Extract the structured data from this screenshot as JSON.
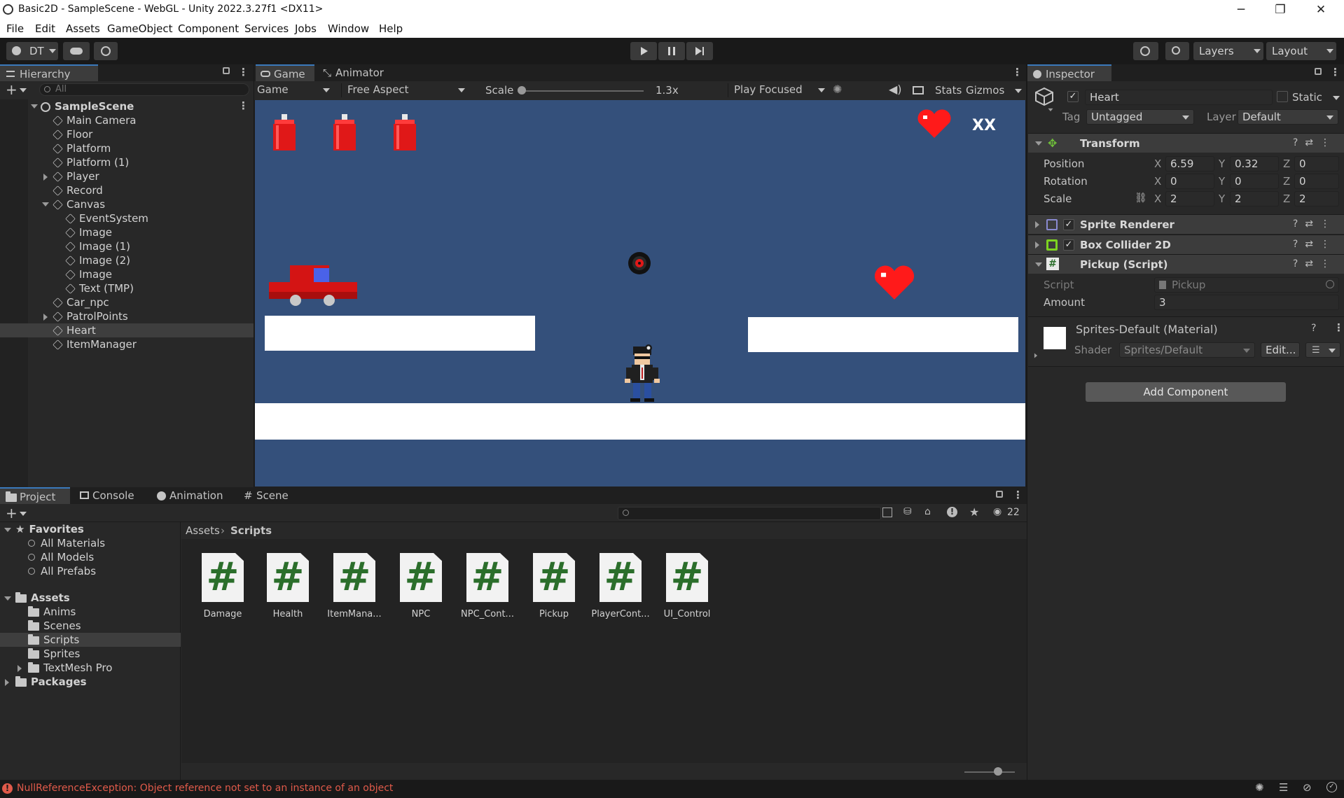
{
  "window": {
    "title": "Basic2D - SampleScene - WebGL - Unity 2022.3.27f1 <DX11>",
    "minimize": "─",
    "restore": "❐",
    "close": "✕"
  },
  "menu": [
    "File",
    "Edit",
    "Assets",
    "GameObject",
    "Component",
    "Services",
    "Jobs",
    "Window",
    "Help"
  ],
  "toolbar": {
    "account": "DT",
    "layers": "Layers",
    "layout": "Layout"
  },
  "hierarchy": {
    "tab": "Hierarchy",
    "search_placeholder": "All",
    "scene": "SampleScene",
    "items": [
      {
        "label": "Main Camera"
      },
      {
        "label": "Floor"
      },
      {
        "label": "Platform"
      },
      {
        "label": "Platform (1)"
      },
      {
        "label": "Player"
      },
      {
        "label": "Record"
      },
      {
        "label": "Canvas"
      },
      {
        "label": "EventSystem"
      },
      {
        "label": "Image"
      },
      {
        "label": "Image (1)"
      },
      {
        "label": "Image (2)"
      },
      {
        "label": "Image"
      },
      {
        "label": "Text (TMP)"
      },
      {
        "label": "Car_npc"
      },
      {
        "label": "PatrolPoints"
      },
      {
        "label": "Heart"
      },
      {
        "label": "ItemManager"
      }
    ]
  },
  "game_view": {
    "tab_game": "Game",
    "tab_animator": "Animator",
    "display": "Game",
    "aspect": "Free Aspect",
    "scale_label": "Scale",
    "scale_value": "1.3x",
    "play_mode": "Play Focused",
    "stats": "Stats",
    "gizmos": "Gizmos",
    "hud_text": "XX"
  },
  "inspector": {
    "tab": "Inspector",
    "object_name": "Heart",
    "static_label": "Static",
    "tag_label": "Tag",
    "tag_value": "Untagged",
    "layer_label": "Layer",
    "layer_value": "Default",
    "transform": {
      "title": "Transform",
      "position_label": "Position",
      "rotation_label": "Rotation",
      "scale_label": "Scale",
      "position": {
        "x": "6.59",
        "y": "0.32",
        "z": "0"
      },
      "rotation": {
        "x": "0",
        "y": "0",
        "z": "0"
      },
      "scale": {
        "x": "2",
        "y": "2",
        "z": "2"
      },
      "x": "X",
      "y": "Y",
      "z": "Z"
    },
    "sprite_renderer": "Sprite Renderer",
    "box_collider": "Box Collider 2D",
    "pickup": {
      "title": "Pickup (Script)",
      "script_label": "Script",
      "script_value": "Pickup",
      "amount_label": "Amount",
      "amount_value": "3"
    },
    "material": {
      "name": "Sprites-Default (Material)",
      "shader_label": "Shader",
      "shader_value": "Sprites/Default",
      "edit": "Edit..."
    },
    "add_component": "Add Component"
  },
  "project": {
    "tabs": [
      "Project",
      "Console",
      "Animation",
      "Scene"
    ],
    "hidden_count": "22",
    "favorites": "Favorites",
    "fav_items": [
      "All Materials",
      "All Models",
      "All Prefabs"
    ],
    "assets": "Assets",
    "asset_folders": [
      "Anims",
      "Scenes",
      "Scripts",
      "Sprites",
      "TextMesh Pro"
    ],
    "packages": "Packages",
    "breadcrumb": [
      "Assets",
      "Scripts"
    ],
    "scripts": [
      "Damage",
      "Health",
      "ItemMana...",
      "NPC",
      "NPC_Cont...",
      "Pickup",
      "PlayerCont...",
      "UI_Control"
    ]
  },
  "status": {
    "error": "NullReferenceException: Object reference not set to an instance of an object"
  },
  "colors": {
    "accent": "#3a79bb",
    "error": "#e05a4a",
    "game_bg": "#34507b"
  }
}
